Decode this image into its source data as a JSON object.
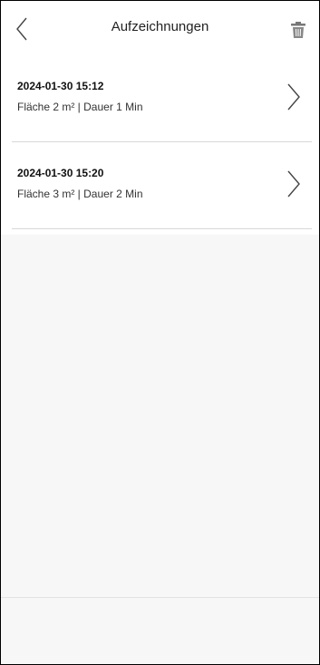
{
  "header": {
    "title": "Aufzeichnungen",
    "back_icon": "chevron-left-icon",
    "delete_icon": "trash-icon"
  },
  "recordings": [
    {
      "datetime": "2024-01-30 15:12",
      "info": "Fläche 2 m²  |  Dauer 1 Min"
    },
    {
      "datetime": "2024-01-30 15:20",
      "info": "Fläche 3 m²  |  Dauer 2 Min"
    }
  ]
}
